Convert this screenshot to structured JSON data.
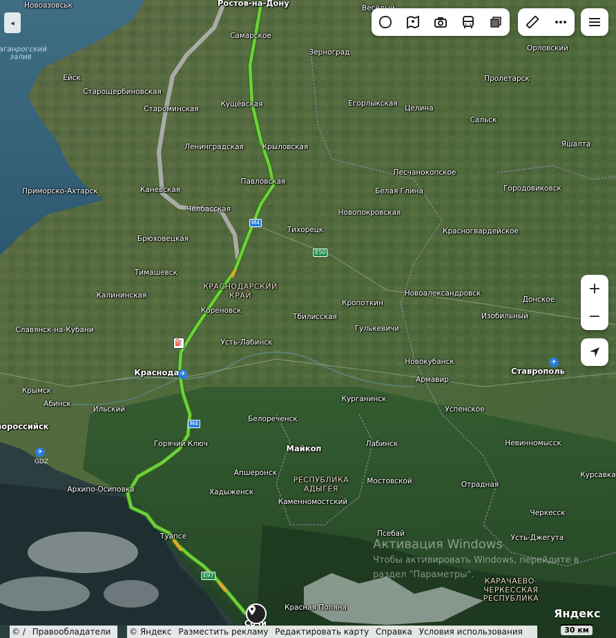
{
  "map": {
    "route_color": "#6fcf3a",
    "alt_route_color": "#a9a9a9",
    "places": [
      {
        "name": "Ростов-на-Дону",
        "type": "city"
      },
      {
        "name": "Новоазовськ"
      },
      {
        "name": "Самарское"
      },
      {
        "name": "Весёлый"
      },
      {
        "name": "Зерноград"
      },
      {
        "name": "Орловский"
      },
      {
        "name": "Ейск"
      },
      {
        "name": "Староминская"
      },
      {
        "name": "Старощербиновская"
      },
      {
        "name": "Кущёвская"
      },
      {
        "name": "Пролетарск"
      },
      {
        "name": "Егорлыкская"
      },
      {
        "name": "Целина"
      },
      {
        "name": "Сальск"
      },
      {
        "name": "Ленинградская"
      },
      {
        "name": "Крыловская"
      },
      {
        "name": "Яшалта"
      },
      {
        "name": "Песчанокопское"
      },
      {
        "name": "Павловская"
      },
      {
        "name": "Белая Глина"
      },
      {
        "name": "Городовиковск"
      },
      {
        "name": "Приморско-Ахтарск"
      },
      {
        "name": "Каневская"
      },
      {
        "name": "Челбасская"
      },
      {
        "name": "Новопокровская"
      },
      {
        "name": "Тихорецк"
      },
      {
        "name": "Красногвардейское"
      },
      {
        "name": "Брюховецкая"
      },
      {
        "name": "Тимашевск"
      },
      {
        "name": "Калининская"
      },
      {
        "name": "Кореновск"
      },
      {
        "name": "Кропоткин"
      },
      {
        "name": "Тбилисская"
      },
      {
        "name": "Гулькевичи"
      },
      {
        "name": "Новоалександровск"
      },
      {
        "name": "Донское"
      },
      {
        "name": "Изобильный"
      },
      {
        "name": "Славянск-на-Кубани"
      },
      {
        "name": "Усть-Лабинск"
      },
      {
        "name": "Краснодар",
        "type": "city"
      },
      {
        "name": "Новокубанск"
      },
      {
        "name": "Армавир"
      },
      {
        "name": "Ставрополь",
        "type": "city"
      },
      {
        "name": "Крымск"
      },
      {
        "name": "Абинск"
      },
      {
        "name": "Ильский"
      },
      {
        "name": "Курганинск"
      },
      {
        "name": "Успенское"
      },
      {
        "name": "Белореченск"
      },
      {
        "name": "Новороссийск"
      },
      {
        "name": "Горячий Ключ"
      },
      {
        "name": "Майкоп",
        "type": "city"
      },
      {
        "name": "Лабинск"
      },
      {
        "name": "Невинномысск"
      },
      {
        "name": "Апшеронск"
      },
      {
        "name": "Мостовской"
      },
      {
        "name": "Курсавка"
      },
      {
        "name": "Архипо-Осиповка"
      },
      {
        "name": "Хадыженск"
      },
      {
        "name": "Отрадная"
      },
      {
        "name": "Каменномостский"
      },
      {
        "name": "Черкесск"
      },
      {
        "name": "Псебай"
      },
      {
        "name": "Туапсе"
      },
      {
        "name": "Усть-Джегута"
      },
      {
        "name": "Красная Поляна"
      },
      {
        "name": "Сочи"
      }
    ],
    "region_labels": [
      {
        "text": "КРАСНОДАРСКИЙ КРАЙ"
      },
      {
        "text": "РЕСПУБЛИКА АДЫГЕЯ"
      },
      {
        "text": "КАРАЧАЕВО-ЧЕРКЕССКАЯ РЕСПУБЛИКА"
      }
    ],
    "water_labels": [
      {
        "text": "Таганрогский залив"
      }
    ],
    "road_shields": [
      "M4",
      "E50",
      "M4",
      "E97"
    ],
    "airports": [
      "GDZ"
    ]
  },
  "controls": {
    "toolbar": [
      "layers-icon",
      "panorama-icon",
      "photo-icon",
      "transit-icon",
      "map-type-icon"
    ],
    "toolbar2": [
      "ruler-icon",
      "more-icon"
    ],
    "menu": "menu-icon",
    "zoom_in": "+",
    "zoom_out": "−",
    "geolocation": "geolocation-icon",
    "collapse": "◂"
  },
  "brand": "Яндекс",
  "scale": "30 км",
  "watermark": {
    "title": "Активация Windows",
    "line1": "Чтобы активировать Windows, перейдите в",
    "line2": "раздел \"Параметры\"."
  },
  "footer": {
    "left": [
      "© /",
      "Правообладатели"
    ],
    "right": [
      "© Яндекс",
      "Разместить рекламу",
      "Редактировать карту",
      "Справка",
      "Условия использования"
    ]
  }
}
